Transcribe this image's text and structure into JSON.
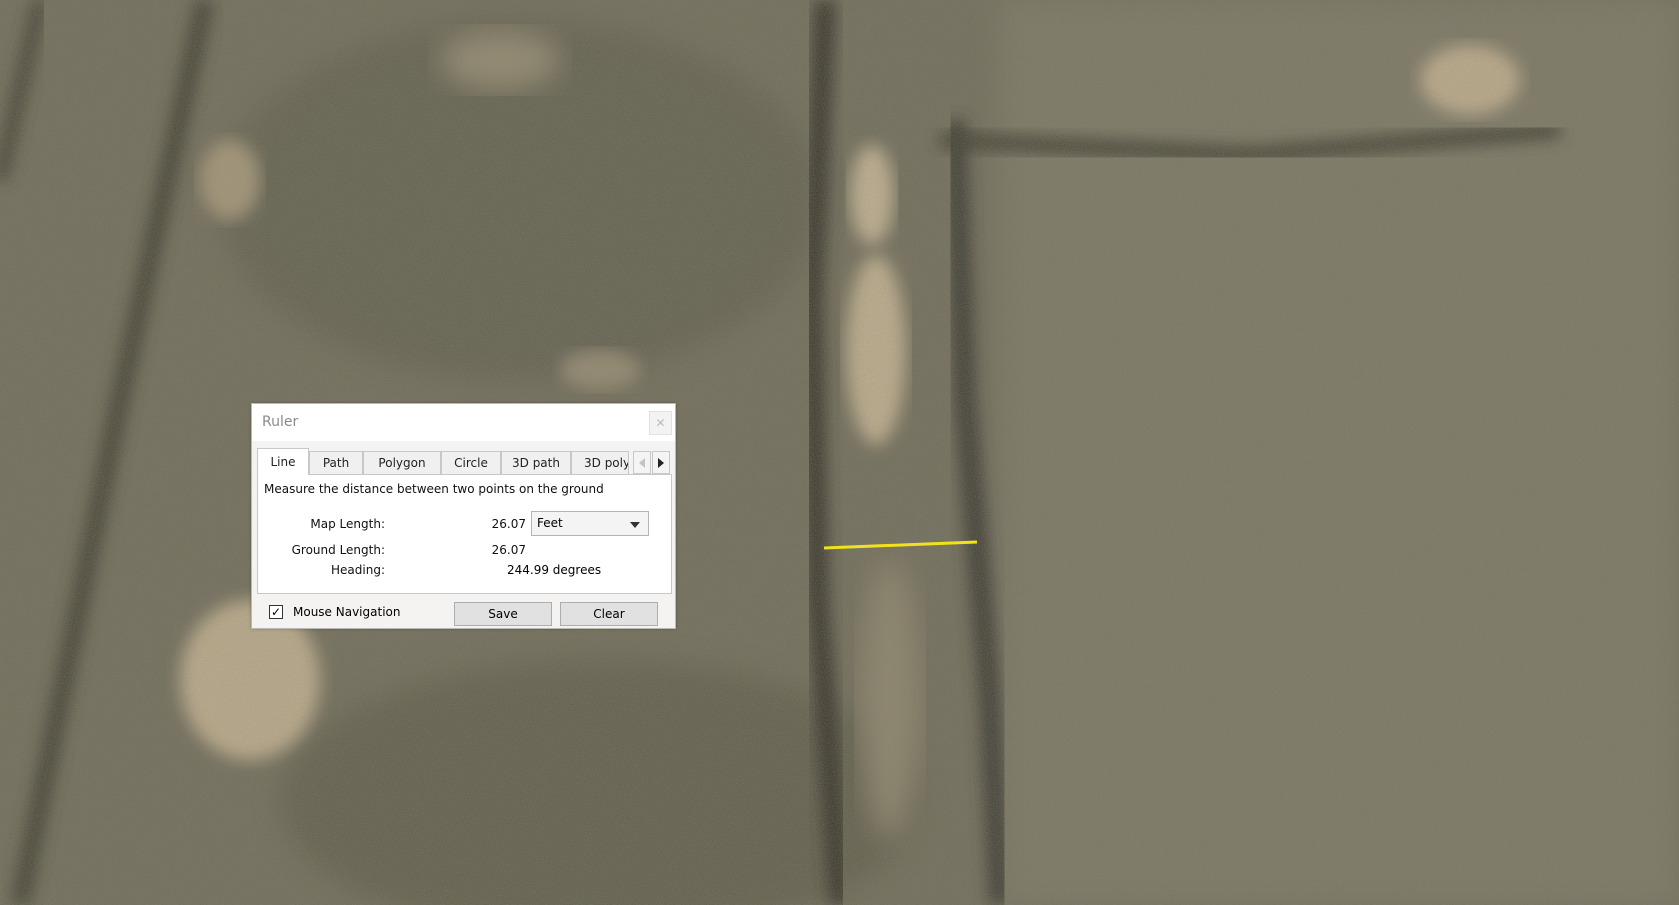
{
  "colors": {
    "terrain_base": "#6f6a58",
    "terrain_dark": "#3e3b2e",
    "terrain_light": "#bfae8c",
    "measure_line": "#f2e21c"
  },
  "ruler": {
    "title": "Ruler",
    "close_icon": "close-icon",
    "tabs": [
      {
        "label": "Line",
        "active": true
      },
      {
        "label": "Path"
      },
      {
        "label": "Polygon"
      },
      {
        "label": "Circle"
      },
      {
        "label": "3D path"
      },
      {
        "label": "3D poly"
      }
    ],
    "description": "Measure the distance between two points on the ground",
    "map_length_label": "Map Length:",
    "map_length_value": "26.07",
    "units_selected": "Feet",
    "ground_length_label": "Ground Length:",
    "ground_length_value": "26.07",
    "heading_label": "Heading:",
    "heading_value": "244.99 degrees",
    "mouse_nav_label": "Mouse Navigation",
    "mouse_nav_checked": "✓",
    "save_label": "Save",
    "clear_label": "Clear"
  }
}
